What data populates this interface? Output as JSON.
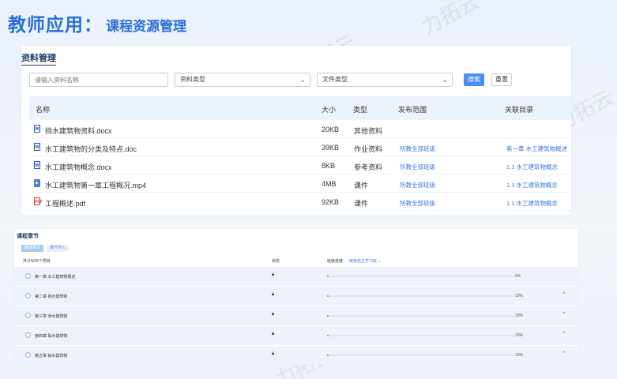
{
  "header": {
    "title_main": "教师应用：",
    "title_sub": "课程资源管理"
  },
  "materials": {
    "title": "资料管理",
    "search_placeholder": "请输入资料名称",
    "type_select": "资料类型",
    "file_type_select": "文件类型",
    "search_button": "搜索",
    "reset_button": "重置",
    "columns": [
      "名称",
      "大小",
      "类型",
      "发布范围",
      "关联目录"
    ],
    "rows": [
      {
        "icon": "word-doc-icon",
        "glyph": "W",
        "name": "挡水建筑物资料.docx",
        "size": "20KB",
        "type": "其他资料",
        "scope": "",
        "catalog": ""
      },
      {
        "icon": "word-doc-icon",
        "glyph": "W",
        "name": "水工建筑物的分类及特点.doc",
        "size": "39KB",
        "type": "作业资料",
        "scope": "所教全部班级",
        "catalog": "第一章 水工建筑物概述"
      },
      {
        "icon": "word-doc-icon",
        "glyph": "W",
        "name": "水工建筑物概念.docx",
        "size": "8KB",
        "type": "参考资料",
        "scope": "所教全部班级",
        "catalog": "1.1 水工建筑物概念"
      },
      {
        "icon": "video-file-icon",
        "glyph": "▶",
        "name": "水工建筑物第一章工程概况.mp4",
        "size": "4MB",
        "type": "课件",
        "scope": "所教全部班级",
        "catalog": "1.1 水工建筑物概念"
      },
      {
        "icon": "pdf-file-icon",
        "glyph": "PDF",
        "name": "工程概述.pdf",
        "size": "92KB",
        "type": "课件",
        "scope": "所教全部班级",
        "catalog": "1.1 水工建筑物概念"
      }
    ]
  },
  "chapters": {
    "title": "课程章节",
    "tab_active": "新增章节",
    "tab_import": "章节导入",
    "total_label": "共计5/22个项目",
    "status_col": "状态",
    "progress_col": "班级进度",
    "progress_filter": "班级自主学习班 ⌄",
    "rows": [
      {
        "name": "第一章 水工建筑物概述",
        "progress": 0.0,
        "pct": "0%",
        "caret": ""
      },
      {
        "name": "第二章 挡水建筑物",
        "progress": 0.01,
        "pct": "10%",
        "caret": "⌃"
      },
      {
        "name": "第三章 泄水建筑物",
        "progress": 0.01,
        "pct": "10%",
        "caret": "⌃"
      },
      {
        "name": "第四章 取水建筑物",
        "progress": 0.01,
        "pct": "10%",
        "caret": "⌃"
      },
      {
        "name": "第五章 输水建筑物",
        "progress": 0.01,
        "pct": "10%",
        "caret": "⌃"
      }
    ]
  },
  "watermark": "力拓云",
  "colors": {
    "accent": "#2b6fd6",
    "primary_button": "#4a90f0",
    "link": "#3b78d8"
  }
}
